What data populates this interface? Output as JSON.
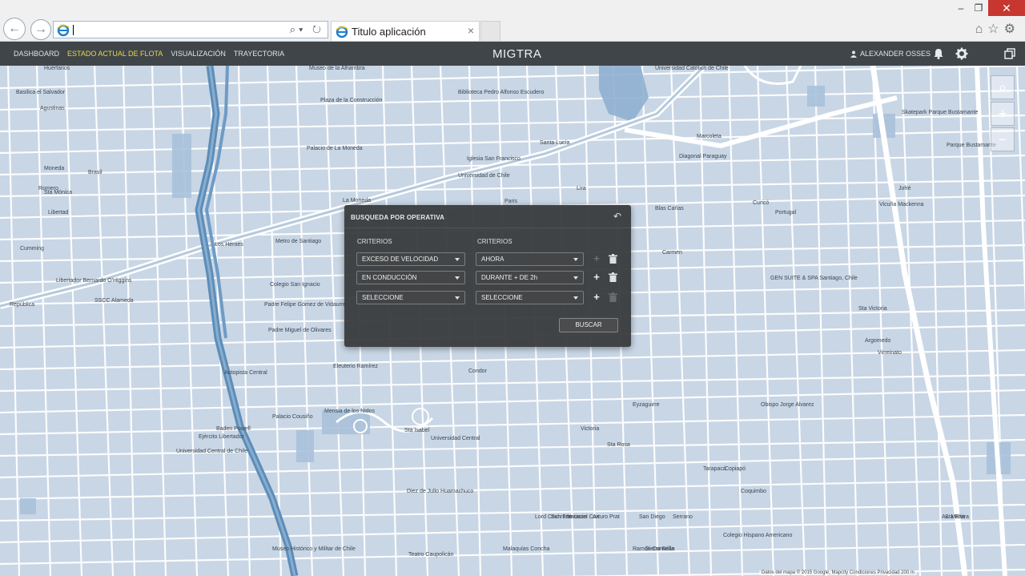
{
  "browser": {
    "address_value": "",
    "tab_title": "Titulo aplicación",
    "tab_close": "×",
    "win_min": "–",
    "win_max": "❐",
    "win_close": "✕",
    "back_glyph": "←",
    "forward_glyph": "→",
    "address_tools": "⌕▾ ↻",
    "right_icons": "⌂☆⚙"
  },
  "app": {
    "nav": [
      "DASHBOARD",
      "ESTADO ACTUAL DE FLOTA",
      "VISUALIZACIÓN",
      "TRAYECTORIA"
    ],
    "active_nav_index": 1,
    "active_color": "#e8d74a",
    "brand": "MIGTRA",
    "user_name": "ALEXANDER OSSES",
    "icons": {
      "bell": "bell-icon",
      "gear": "gear-icon",
      "restore": "restore-window-icon"
    }
  },
  "map": {
    "controls": {
      "search": "⌕",
      "zoom_in": "+",
      "zoom_out": "−"
    },
    "attribution": "Datos del mapa © 2015 Google, Mapcity   Condiciones   Privacidad   200 m",
    "labels": [
      "Huérfanos",
      "Agustinas",
      "Basilica el Salvador",
      "Moneda",
      "Brasil",
      "Sta Mónica",
      "Romero",
      "Libertad",
      "Cumming",
      "Libertador Bernardo O'Higgins",
      "República",
      "SSCC Alameda",
      "Plaza de la Construcción",
      "Biblioteca Pedro Alfonso Escudero",
      "Palacio de La Moneda",
      "La Moneda",
      "Iglesia San Francisco",
      "Universidad de Chile",
      "Santa Lucía",
      "Paris",
      "Metro de Santiago",
      "Los Héroes",
      "Colegio San Ignacio",
      "Padre Felipe Gómez de Vidaurre",
      "Padre Miguel de Olivares",
      "Eleuterio Ramírez",
      "Condor",
      "Sta Isabel",
      "Mensia de los Nidos",
      "Palacio Cousiño",
      "Baden Powell",
      "Universidad Central de Chile",
      "Universidad Central",
      "Diez de Julio Huamachuco",
      "Autopista Central",
      "Ejército Libertador",
      "Teatro Caupolicán",
      "Museo Histórico y Militar de Chile",
      "Universidad Católica de Chile",
      "Diagonal Paraguay",
      "Marcoleta",
      "Curicó",
      "Portugal",
      "Lira",
      "Carmen",
      "Vicuña Mackenna",
      "GEN SUITE & SPA Santiago, Chile",
      "Sta Victoria",
      "Argomedo",
      "Virreinato",
      "Skatepark Parque Bustamante",
      "Parque Bustamante",
      "Colegio Hispano Americano",
      "Sta Elvira",
      "Av. Matta",
      "Coquimbo",
      "Copiapó",
      "Tarapacá",
      "Serrano",
      "San Diego",
      "Arturo Prat",
      "Nataniel Cox",
      "Lord Cochrane",
      "San Francisco",
      "Eyzaguirre",
      "Sta Rosa",
      "Victoria",
      "Jofré",
      "Blas Cañas",
      "Obispo Jorge Alvarez",
      "Museo de la Alhambra",
      "Ramón Corvalán",
      "Sierra Bella",
      "Malaquías Concha"
    ]
  },
  "dialog": {
    "title": "BUSQUEDA POR OPERATIVA",
    "back_icon": "↶",
    "col1_header": "CRITERIOS",
    "col2_header": "CRITERIOS",
    "rows": [
      {
        "left": "EXCESO DE VELOCIDAD",
        "right": "AHORA",
        "plus_enabled": false,
        "trash_enabled": true
      },
      {
        "left": "EN CONDUCCIÓN",
        "right": "DURANTE + DE 2h",
        "plus_enabled": true,
        "trash_enabled": true
      },
      {
        "left": "SELECCIONE",
        "right": "SELECCIONE",
        "plus_enabled": true,
        "trash_enabled": false
      }
    ],
    "plus_glyph": "+",
    "trash_glyph": "🗑",
    "search_button": "BUSCAR"
  }
}
